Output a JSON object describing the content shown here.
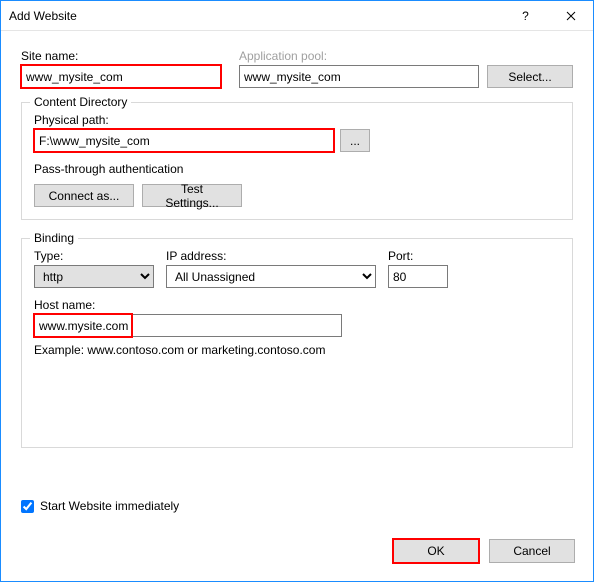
{
  "window": {
    "title": "Add Website"
  },
  "site_name": {
    "label": "Site name:",
    "value": "www_mysite_com"
  },
  "app_pool": {
    "label": "Application pool:",
    "value": "www_mysite_com",
    "select_btn": "Select..."
  },
  "content_dir": {
    "legend": "Content Directory",
    "physical_path_label": "Physical path:",
    "physical_path_value": "F:\\www_mysite_com",
    "browse_btn": "...",
    "passthrough_label": "Pass-through authentication",
    "connect_as_btn": "Connect as...",
    "test_settings_btn": "Test Settings..."
  },
  "binding": {
    "legend": "Binding",
    "type_label": "Type:",
    "type_value": "http",
    "ip_label": "IP address:",
    "ip_value": "All Unassigned",
    "port_label": "Port:",
    "port_value": "80",
    "host_label": "Host name:",
    "host_value": "www.mysite.com",
    "example": "Example: www.contoso.com or marketing.contoso.com"
  },
  "start_immediately": {
    "label": "Start Website immediately",
    "checked": true
  },
  "buttons": {
    "ok": "OK",
    "cancel": "Cancel"
  }
}
